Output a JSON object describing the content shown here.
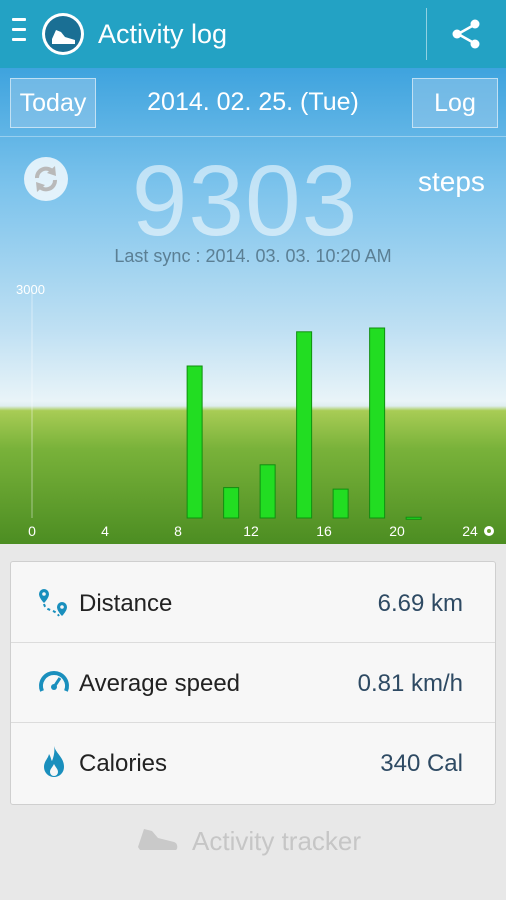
{
  "header": {
    "title": "Activity log"
  },
  "date_nav": {
    "today_label": "Today",
    "date": "2014. 02. 25. (Tue)",
    "log_label": "Log"
  },
  "summary": {
    "steps_value": "9303",
    "steps_unit": "steps",
    "last_sync": "Last sync : 2014. 03. 03. 10:20 AM"
  },
  "chart_data": {
    "type": "bar",
    "x_ticks": [
      "0",
      "4",
      "8",
      "12",
      "16",
      "20",
      "24"
    ],
    "y_max_label": "3000",
    "ylim": [
      0,
      3000
    ],
    "bar_color": "#22dd22",
    "bars": [
      {
        "start_hour": 8.5,
        "value": 2000
      },
      {
        "start_hour": 10.5,
        "value": 400
      },
      {
        "start_hour": 12.5,
        "value": 700
      },
      {
        "start_hour": 14.5,
        "value": 2450
      },
      {
        "start_hour": 16.5,
        "value": 380
      },
      {
        "start_hour": 18.5,
        "value": 2500
      },
      {
        "start_hour": 20.5,
        "value": 10
      }
    ]
  },
  "stats": [
    {
      "icon": "distance-icon",
      "label": "Distance",
      "value": "6.69 km"
    },
    {
      "icon": "speed-icon",
      "label": "Average speed",
      "value": "0.81 km/h"
    },
    {
      "icon": "flame-icon",
      "label": "Calories",
      "value": "340 Cal"
    }
  ],
  "footer": {
    "label": "Activity tracker",
    "icon": "shoe-icon"
  },
  "colors": {
    "appbar": "#23a2c4",
    "icon_accent": "#1a8fbd",
    "value_text": "#2e4a63"
  }
}
